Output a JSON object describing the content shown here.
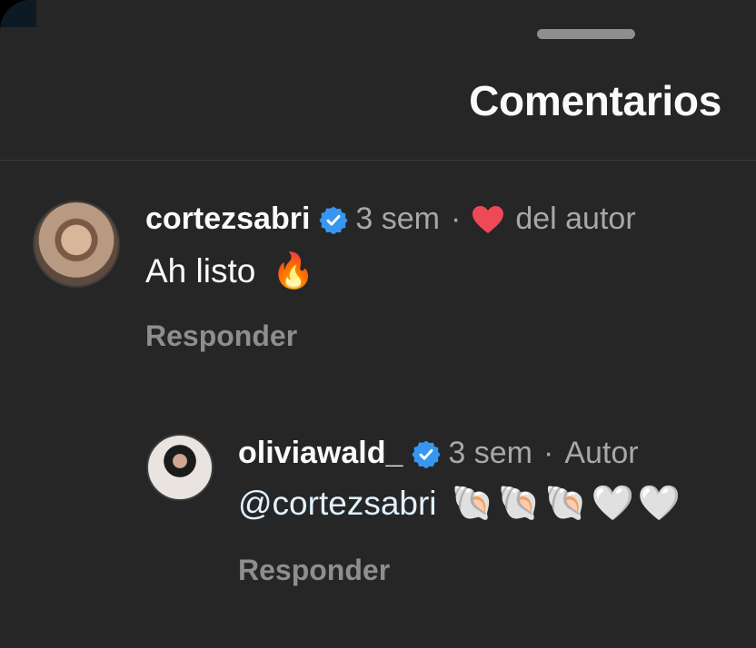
{
  "header": {
    "title": "Comentarios"
  },
  "comments": [
    {
      "username": "cortezsabri",
      "time": "3 sem",
      "separator": "·",
      "liked_label": "del autor",
      "text": "Ah listo",
      "emoji": "🔥",
      "reply_label": "Responder"
    },
    {
      "username": "oliviawald_",
      "time": "3 sem",
      "separator": "·",
      "author_label": "Autor",
      "mention": "@cortezsabri",
      "emojis": [
        "🐚",
        "🐚",
        "🐚",
        "🤍",
        "🤍"
      ],
      "reply_label": "Responder"
    }
  ],
  "colors": {
    "background": "#262626",
    "verified": "#3797f0",
    "heart": "#ed4956",
    "muted": "#a8a8a8",
    "mention": "#e0f1ff"
  },
  "icons": [
    "verified-badge-icon",
    "heart-icon"
  ]
}
